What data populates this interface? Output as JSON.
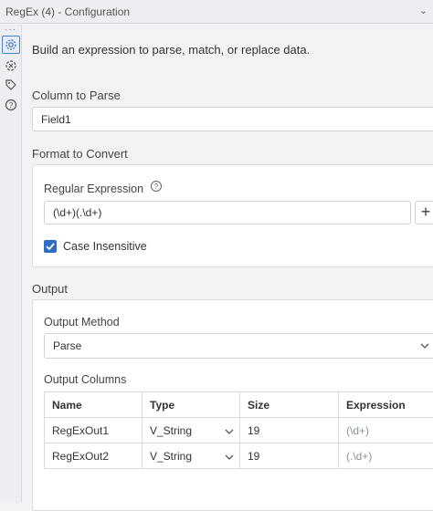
{
  "window": {
    "title": "RegEx (4) - Configuration"
  },
  "iconbar": {
    "items": [
      "gear-icon",
      "tool-icon",
      "tag-icon",
      "help-icon"
    ]
  },
  "description": "Build an expression to parse, match, or replace data.",
  "column_to_parse": {
    "label": "Column to Parse",
    "value": "Field1"
  },
  "format_to_convert": {
    "label": "Format to Convert",
    "regex_label": "Regular Expression",
    "regex_value": "(\\d+)(.\\d+)",
    "plus_label": "+",
    "case_insensitive_label": "Case Insensitive",
    "case_insensitive_checked": true
  },
  "output": {
    "label": "Output",
    "method_label": "Output Method",
    "method_value": "Parse",
    "columns_label": "Output Columns",
    "headers": [
      "Name",
      "Type",
      "Size",
      "Expression"
    ],
    "rows": [
      {
        "name": "RegExOut1",
        "type": "V_String",
        "size": "19",
        "expression": "(\\d+)"
      },
      {
        "name": "RegExOut2",
        "type": "V_String",
        "size": "19",
        "expression": "(.\\d+)"
      }
    ]
  },
  "colors": {
    "accent": "#2f6dc2",
    "panel_border": "#d7dadf",
    "background": "#f3f3f3"
  }
}
